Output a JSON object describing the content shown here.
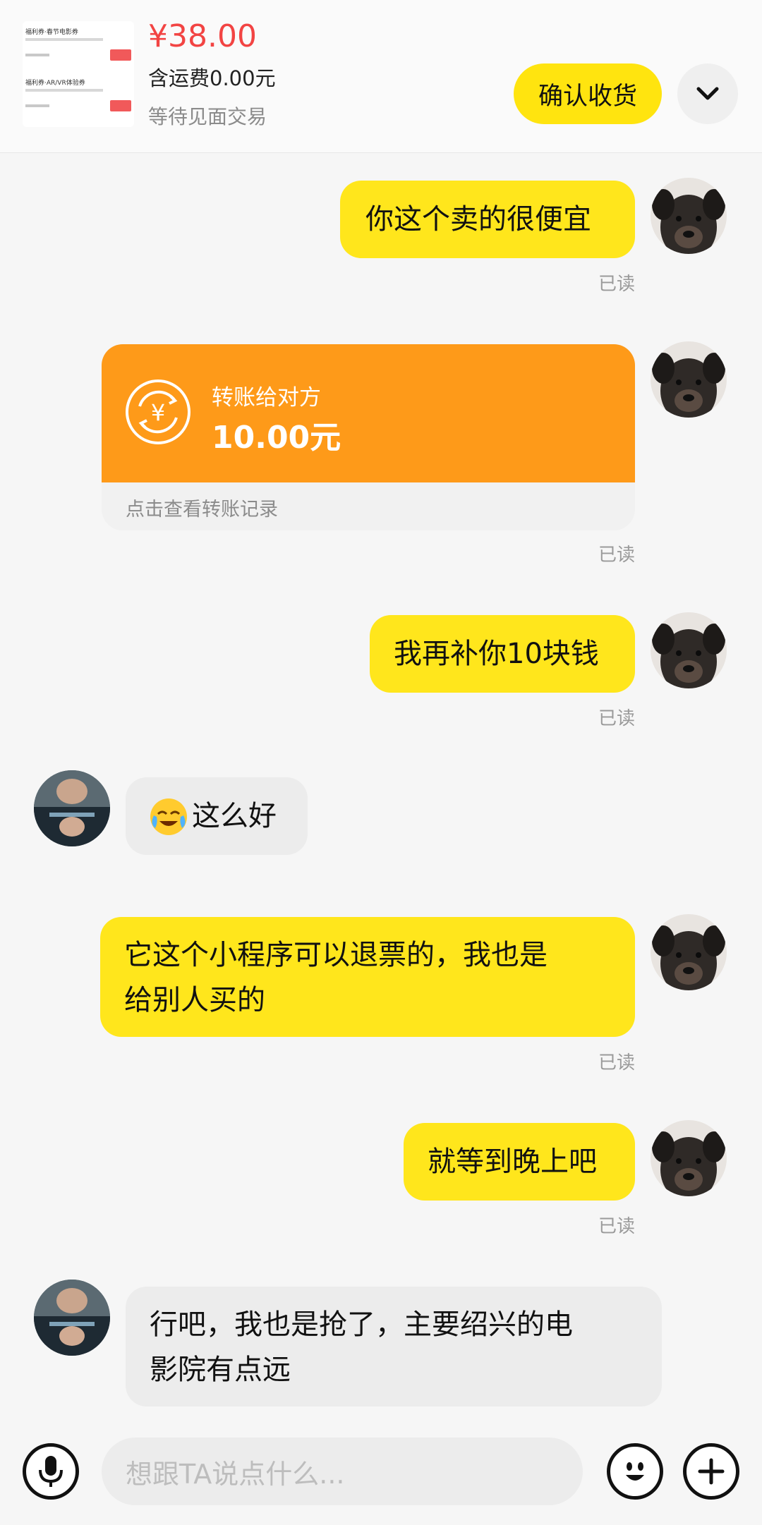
{
  "header": {
    "thumbnail": {
      "row1_title": "福利券·春节电影券",
      "row2_title": "福利券·AR/VR体验券"
    },
    "price": "¥38.00",
    "shipping": "含运费0.00元",
    "status": "等待见面交易",
    "confirm_label": "确认收货"
  },
  "messages": {
    "m1": {
      "text": "你这个卖的很便宜",
      "read": "已读"
    },
    "transfer": {
      "label": "转账给对方",
      "amount": "10.00元",
      "link": "点击查看转账记录",
      "read": "已读"
    },
    "m3": {
      "text": "我再补你10块钱",
      "read": "已读"
    },
    "m4": {
      "text": "这么好"
    },
    "m5": {
      "line1": "它这个小程序可以退票的，我也是",
      "line2": "给别人买的",
      "read": "已读"
    },
    "m6": {
      "text": "就等到晚上吧",
      "read": "已读"
    },
    "m7": {
      "line1": "行吧，我也是抢了，主要绍兴的电",
      "line2": "影院有点远"
    }
  },
  "input": {
    "placeholder": "想跟TA说点什么..."
  },
  "colors": {
    "my_bubble": "#ffe61c",
    "their_bubble": "#ececec",
    "transfer_orange": "#fe9a19",
    "price_red": "#f24443",
    "confirm_yellow": "#ffe40f"
  }
}
